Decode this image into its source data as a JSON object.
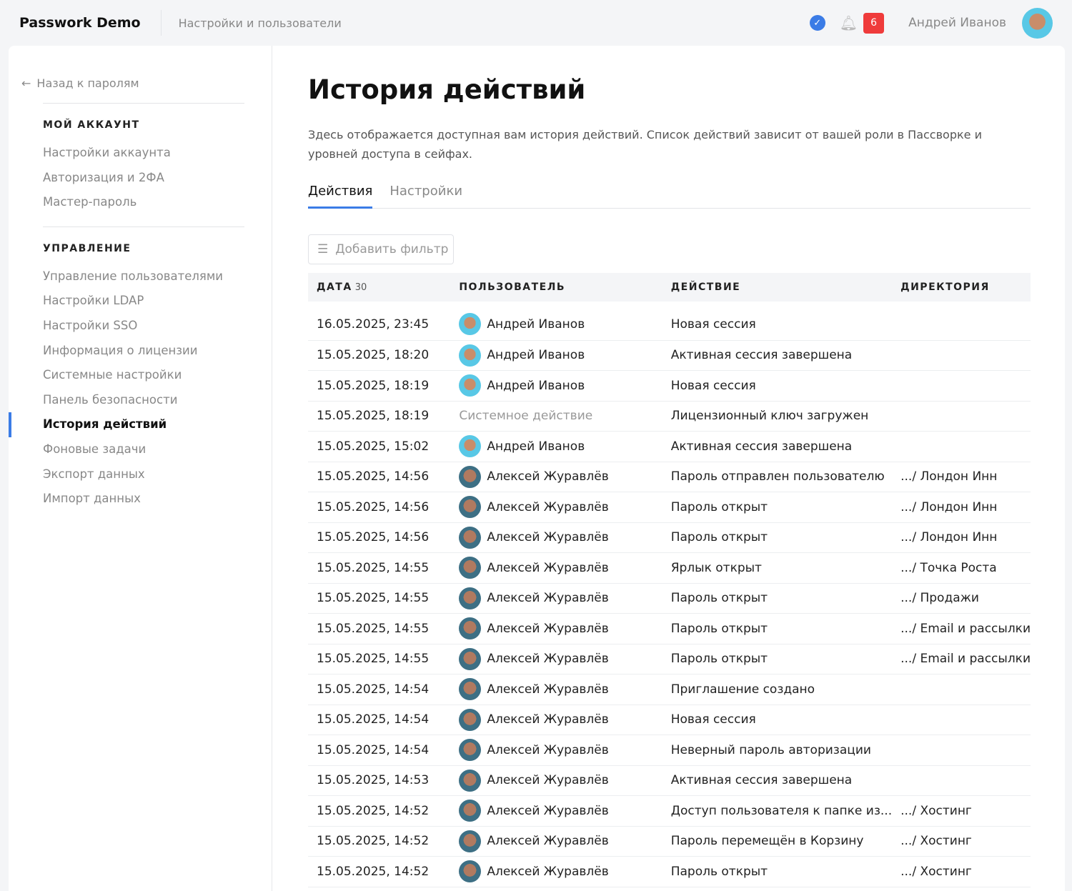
{
  "header": {
    "brand": "Passwork Demo",
    "breadcrumb": "Настройки и пользователи",
    "notifications": "6",
    "user": "Андрей Иванов"
  },
  "sidebar": {
    "back": "Назад к паролям",
    "sections": [
      {
        "title": "МОЙ АККАУНТ",
        "items": [
          "Настройки аккаунта",
          "Авторизация и 2ФА",
          "Мастер-пароль"
        ]
      },
      {
        "title": "УПРАВЛЕНИЕ",
        "items": [
          "Управление пользователями",
          "Настройки LDAP",
          "Настройки SSO",
          "Информация о лицензии",
          "Системные настройки",
          "Панель безопасности",
          "История действий",
          "Фоновые задачи",
          "Экспорт данных",
          "Импорт данных"
        ]
      }
    ],
    "active": "История действий"
  },
  "main": {
    "title": "История действий",
    "description": "Здесь отображается доступная вам история действий. Список действий зависит от вашей роли в Пассворке и уровней доступа в сейфах.",
    "tabs": [
      "Действия",
      "Настройки"
    ],
    "filter": "Добавить фильтр",
    "columns": {
      "date": "ДАТА",
      "date_count": "30",
      "user": "ПОЛЬЗОВАТЕЛЬ",
      "action": "ДЕЙСТВИЕ",
      "dir": "ДИРЕКТОРИЯ"
    },
    "rows": [
      [
        "16.05.2025, 23:45",
        "Андрей Иванов",
        "Новая сессия",
        ""
      ],
      [
        "15.05.2025, 18:20",
        "Андрей Иванов",
        "Активная сессия завершена",
        ""
      ],
      [
        "15.05.2025, 18:19",
        "Андрей Иванов",
        "Новая сессия",
        ""
      ],
      [
        "15.05.2025, 18:19",
        "Системное действие",
        "Лицензионный ключ загружен",
        ""
      ],
      [
        "15.05.2025, 15:02",
        "Андрей Иванов",
        "Активная сессия завершена",
        ""
      ],
      [
        "15.05.2025, 14:56",
        "Алексей Журавлёв",
        "Пароль отправлен пользователю",
        ".../ Лондон Инн"
      ],
      [
        "15.05.2025, 14:56",
        "Алексей Журавлёв",
        "Пароль открыт",
        ".../ Лондон Инн"
      ],
      [
        "15.05.2025, 14:56",
        "Алексей Журавлёв",
        "Пароль открыт",
        ".../ Лондон Инн"
      ],
      [
        "15.05.2025, 14:55",
        "Алексей Журавлёв",
        "Ярлык открыт",
        ".../ Точка Роста"
      ],
      [
        "15.05.2025, 14:55",
        "Алексей Журавлёв",
        "Пароль открыт",
        ".../ Продажи"
      ],
      [
        "15.05.2025, 14:55",
        "Алексей Журавлёв",
        "Пароль открыт",
        ".../ Email и рассылки"
      ],
      [
        "15.05.2025, 14:55",
        "Алексей Журавлёв",
        "Пароль открыт",
        ".../ Email и рассылки"
      ],
      [
        "15.05.2025, 14:54",
        "Алексей Журавлёв",
        "Приглашение создано",
        ""
      ],
      [
        "15.05.2025, 14:54",
        "Алексей Журавлёв",
        "Новая сессия",
        ""
      ],
      [
        "15.05.2025, 14:54",
        "Алексей Журавлёв",
        "Неверный пароль авторизации",
        ""
      ],
      [
        "15.05.2025, 14:53",
        "Алексей Журавлёв",
        "Активная сессия завершена",
        ""
      ],
      [
        "15.05.2025, 14:52",
        "Алексей Журавлёв",
        "Доступ пользователя к папке из...",
        ".../ Хостинг"
      ],
      [
        "15.05.2025, 14:52",
        "Алексей Журавлёв",
        "Пароль перемещён в Корзину",
        ".../ Хостинг"
      ],
      [
        "15.05.2025, 14:52",
        "Алексей Журавлёв",
        "Пароль открыт",
        ".../ Хостинг"
      ]
    ]
  }
}
